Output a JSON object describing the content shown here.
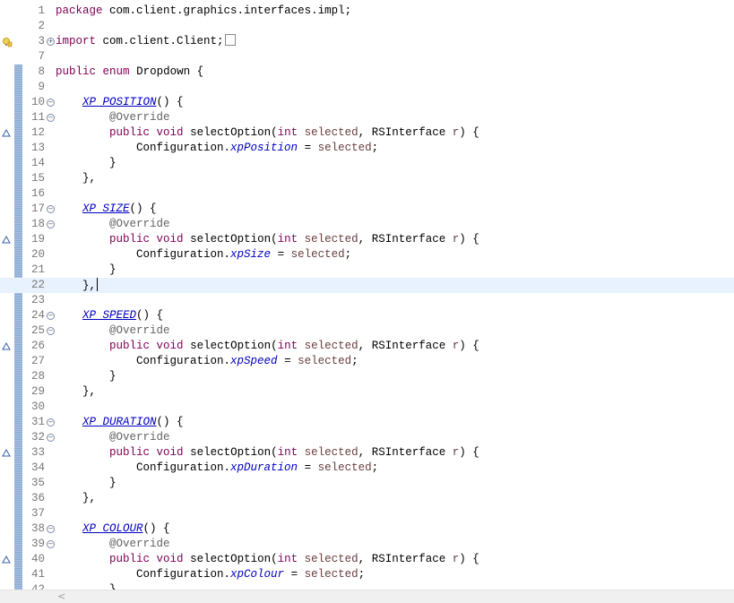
{
  "editor": {
    "file_tokens": {
      "kw_package": "package",
      "pkg_name": "com.client.graphics.interfaces.impl;",
      "kw_import": "import",
      "import_name": "com.client.Client;",
      "kw_public": "public",
      "kw_enum": "enum",
      "enum_name": "Dropdown {",
      "override": "@Override",
      "kw_void": "void",
      "method": "selectOption(",
      "kw_int": "int",
      "param_selected": "selected",
      "comma": ",",
      "type_rs": "RSInterface",
      "param_r": "r",
      "method_tail": ") {",
      "config": "Configuration.",
      "assign": " = ",
      "semicolon": ";",
      "close_brace": "}",
      "close_const": "},",
      "const_open": "() {"
    },
    "constants": [
      {
        "name": "XP_POSITION",
        "field": "xpPosition"
      },
      {
        "name": "XP_SIZE",
        "field": "xpSize"
      },
      {
        "name": "XP_SPEED",
        "field": "xpSpeed"
      },
      {
        "name": "XP_DURATION",
        "field": "xpDuration"
      },
      {
        "name": "XP_COLOUR",
        "field": "xpColour"
      }
    ],
    "line_numbers": [
      "1",
      "2",
      "3",
      "7",
      "8",
      "9",
      "10",
      "11",
      "12",
      "13",
      "14",
      "15",
      "16",
      "17",
      "18",
      "19",
      "20",
      "21",
      "22",
      "23",
      "24",
      "25",
      "26",
      "27",
      "28",
      "29",
      "30",
      "31",
      "32",
      "33",
      "34",
      "35",
      "36",
      "37",
      "38",
      "39",
      "40",
      "41",
      "42"
    ],
    "current_line": "22",
    "colors": {
      "keyword": "#7f0055",
      "annotation": "#646464",
      "field": "#0000c0",
      "current_line_bg": "#e8f2fe",
      "line_number": "#787878"
    },
    "icons": [
      "warning-lightbulb-icon",
      "override-marker-icon",
      "fold-collapse-icon",
      "fold-expand-icon",
      "scroll-left-icon"
    ]
  }
}
